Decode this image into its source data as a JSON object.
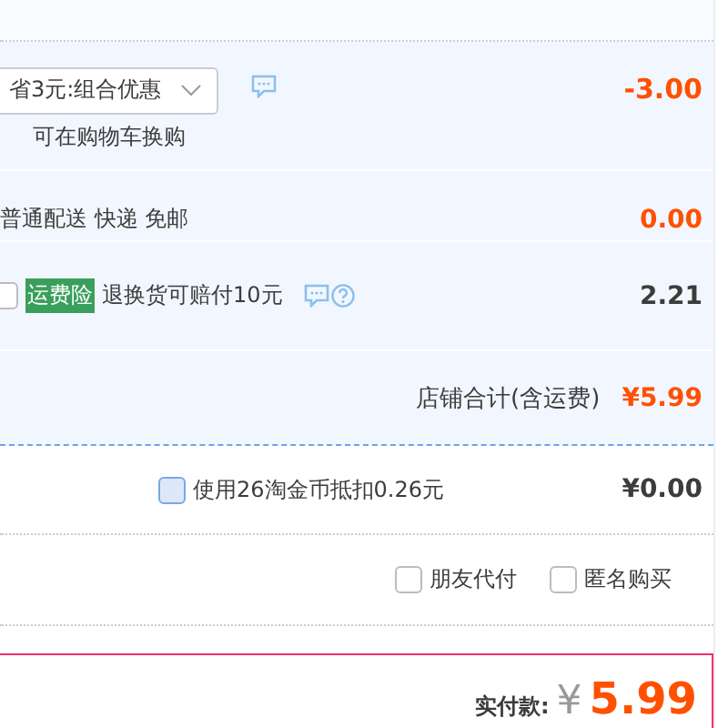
{
  "promo": {
    "selected_option": "省3元:组合优惠",
    "note": "可在购物车换购",
    "amount": "-3.00"
  },
  "shipping": {
    "label": "普通配送 快递 免邮",
    "amount": "0.00"
  },
  "insurance": {
    "checked": false,
    "badge": "运费险",
    "label": "退换货可赔付10元",
    "amount": "2.21"
  },
  "store_total": {
    "label": "店铺合计(含运费)",
    "amount": "¥5.99"
  },
  "coins": {
    "checked": false,
    "label": "使用26淘金币抵扣0.26元",
    "amount": "¥0.00"
  },
  "options": [
    {
      "label": "朋友代付",
      "checked": false
    },
    {
      "label": "匿名购买",
      "checked": false
    }
  ],
  "payment": {
    "label": "实付款:",
    "currency": "¥",
    "amount": "5.99"
  }
}
